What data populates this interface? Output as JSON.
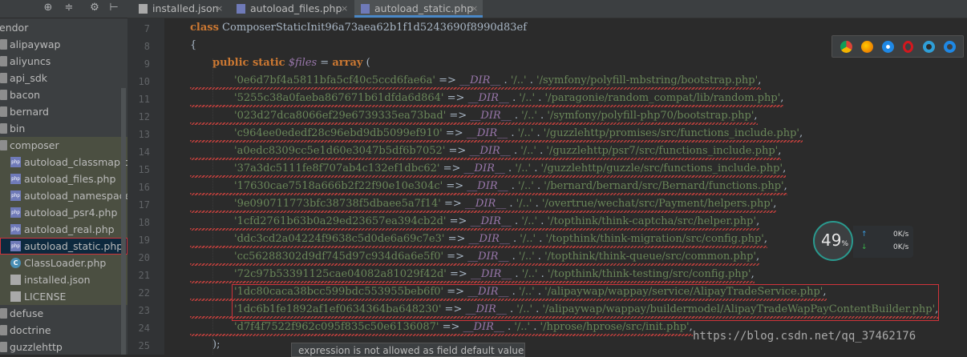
{
  "sidebar": {
    "tools": [
      "⊕",
      "≑",
      "⚙",
      "⊢"
    ],
    "items": [
      {
        "label": "endor",
        "type": "folder-open",
        "indent": 0
      },
      {
        "label": "alipaywap",
        "type": "folder",
        "indent": 1
      },
      {
        "label": "aliyuncs",
        "type": "folder",
        "indent": 1
      },
      {
        "label": "api_sdk",
        "type": "folder",
        "indent": 1
      },
      {
        "label": "bacon",
        "type": "folder",
        "indent": 1
      },
      {
        "label": "bernard",
        "type": "folder",
        "indent": 1
      },
      {
        "label": "bin",
        "type": "folder",
        "indent": 1
      },
      {
        "label": "composer",
        "type": "folder",
        "indent": 1
      },
      {
        "label": "autoload_classmap.php",
        "type": "php",
        "indent": 2
      },
      {
        "label": "autoload_files.php",
        "type": "php",
        "indent": 2
      },
      {
        "label": "autoload_namespaces",
        "type": "php",
        "indent": 2
      },
      {
        "label": "autoload_psr4.php",
        "type": "php",
        "indent": 2
      },
      {
        "label": "autoload_real.php",
        "type": "php",
        "indent": 2
      },
      {
        "label": "autoload_static.php",
        "type": "php",
        "indent": 2
      },
      {
        "label": "ClassLoader.php",
        "type": "class",
        "indent": 2
      },
      {
        "label": "installed.json",
        "type": "json",
        "indent": 2
      },
      {
        "label": "LICENSE",
        "type": "license",
        "indent": 2
      },
      {
        "label": "defuse",
        "type": "folder",
        "indent": 1
      },
      {
        "label": "doctrine",
        "type": "folder",
        "indent": 1
      },
      {
        "label": "guzzlehttp",
        "type": "folder",
        "indent": 1
      }
    ]
  },
  "tabs": [
    {
      "label": "installed.json",
      "close": "×"
    },
    {
      "label": "autoload_files.php",
      "close": "×"
    },
    {
      "label": "autoload_static.php",
      "close": "×"
    }
  ],
  "editor": {
    "line_numbers": [
      "7",
      "8",
      "9",
      "10",
      "11",
      "12",
      "13",
      "14",
      "15",
      "16",
      "17",
      "18",
      "19",
      "20",
      "21",
      "22",
      "23",
      "24",
      "25"
    ],
    "class_line": {
      "kw": "class",
      "name": " ComposerStaticInit96a73aea62b1f1d5243690f8990d83ef"
    },
    "brace_open": "{",
    "files_line": {
      "kw": "public static",
      "var": "$files",
      "eq": " = ",
      "arr": "array",
      "paren": " ("
    },
    "entries": [
      {
        "hash": "'0e6d7bf4a5811bfa5cf40c5ccd6fae6a'",
        "path": "'/symfony/polyfill-mbstring/bootstrap.php'"
      },
      {
        "hash": "'5255c38a0faeba867671b61dfda6d864'",
        "path": "'/paragonie/random_compat/lib/random.php'"
      },
      {
        "hash": "'023d27dca8066ef29e6739335ea73bad'",
        "path": "'/symfony/polyfill-php70/bootstrap.php'"
      },
      {
        "hash": "'c964ee0ededf28c96ebd9db5099ef910'",
        "path": "'/guzzlehttp/promises/src/functions_include.php'"
      },
      {
        "hash": "'a0edc8309cc5e1d60e3047b5df6b7052'",
        "path": "'/guzzlehttp/psr7/src/functions_include.php'"
      },
      {
        "hash": "'37a3dc5111fe8f707ab4c132ef1dbc62'",
        "path": "'/guzzlehttp/guzzle/src/functions_include.php'"
      },
      {
        "hash": "'17630cae7518a666b2f22f90e10e304c'",
        "path": "'/bernard/bernard/src/Bernard/functions.php'"
      },
      {
        "hash": "'9e090711773bfc38738f5dbaee5a7f14'",
        "path": "'/overtrue/wechat/src/Payment/helpers.php'"
      },
      {
        "hash": "'1cfd2761b63b0a29ed23657ea394cb2d'",
        "path": "'/topthink/think-captcha/src/helper.php'"
      },
      {
        "hash": "'ddc3cd2a04224f9638c5d0de6a69c7e3'",
        "path": "'/topthink/think-migration/src/config.php'"
      },
      {
        "hash": "'cc56288302d9df745d97c934d6a6e5f0'",
        "path": "'/topthink/think-queue/src/common.php'"
      },
      {
        "hash": "'72c97b53391125cae04082a81029f42d'",
        "path": "'/topthink/think-testing/src/config.php'"
      },
      {
        "hash": "'1dc80caca38bcc599bdc553955beb6f0'",
        "path": "'/alipaywap/wappay/service/AlipayTradeService.php'"
      },
      {
        "hash": "'1dc6b1fe1892af1ef0634364ba648230'",
        "path": "'/alipaywap/wappay/buildermodel/AlipayTradeWapPayContentBuilder.php'"
      },
      {
        "hash": "'d7f4f7522f962c095f835c50e6136087'",
        "path": "'/hprose/hprose/src/init.php'"
      }
    ],
    "arrow": " => ",
    "dir": "__DIR__",
    "dot": " . ",
    "updir": "'/..'",
    "comma": ",",
    "close_line": ");"
  },
  "tooltip": "expression is not allowed as field default value",
  "monitor": {
    "percent": "49",
    "percent_sign": "%",
    "up_arrow": "↑",
    "down_arrow": "↓",
    "up": "0K/s",
    "down": "0K/s"
  },
  "watermark": "https://blog.csdn.net/qq_37462176",
  "browser_icons": [
    "chrome-icon",
    "firefox-icon",
    "safari-icon",
    "opera-icon",
    "ie-icon",
    "edge-icon"
  ],
  "colors": {
    "keyword": "#cc7832",
    "string": "#6a8759",
    "variable": "#9876aa",
    "error": "#bc3f3c",
    "highlight_box": "#d0333a",
    "selection": "#0d293e",
    "accent": "#4a88c7"
  }
}
